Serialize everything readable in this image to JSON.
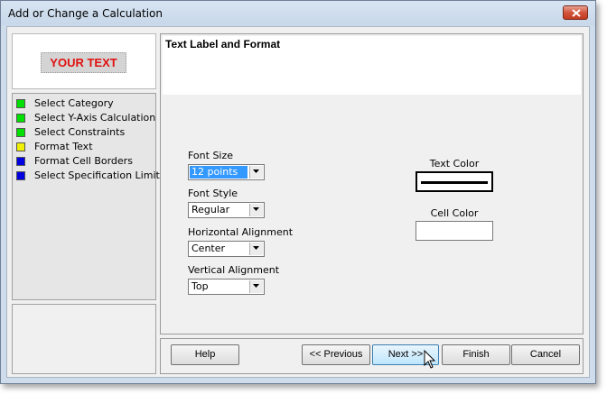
{
  "window": {
    "title": "Add or Change a Calculation"
  },
  "logo": {
    "text": "YOUR TEXT"
  },
  "steps": [
    {
      "label": "Select Category",
      "color": "#00e000"
    },
    {
      "label": "Select Y-Axis Calculation",
      "color": "#00e000"
    },
    {
      "label": "Select Constraints",
      "color": "#00e000"
    },
    {
      "label": "Format Text",
      "color": "#f0f000"
    },
    {
      "label": "Format Cell Borders",
      "color": "#0000e0"
    },
    {
      "label": "Select Specification Limits",
      "color": "#0000e0"
    }
  ],
  "panel": {
    "title": "Text Label and Format",
    "font_size": {
      "label": "Font Size",
      "value": "12 points"
    },
    "font_style": {
      "label": "Font Style",
      "value": "Regular"
    },
    "h_align": {
      "label": "Horizontal Alignment",
      "value": "Center"
    },
    "v_align": {
      "label": "Vertical Alignment",
      "value": "Top"
    },
    "text_color": {
      "label": "Text Color",
      "value": "#000000"
    },
    "cell_color": {
      "label": "Cell Color",
      "value": "#ffffff"
    }
  },
  "buttons": {
    "help": "Help",
    "previous": "<< Previous",
    "next": "Next >>",
    "finish": "Finish",
    "cancel": "Cancel"
  }
}
